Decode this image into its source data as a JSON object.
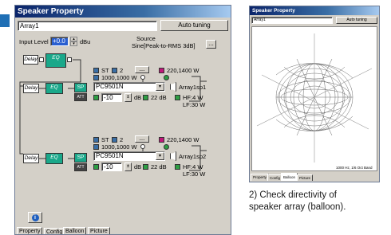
{
  "left_window": {
    "title": "Speaker Property",
    "name_value": "Array1",
    "auto_tuning": "Auto tuning",
    "input_level_label": "Input Level",
    "input_level_value": "+0.0",
    "input_level_unit": "dBu",
    "source_label": "Source",
    "source_value": "Sine[Peak-to-RMS 3dB]",
    "browse_label": "...",
    "blocks": {
      "delay": "Delay",
      "eq": "EQ",
      "sp": "SP",
      "att": "ATT"
    },
    "units": [
      {
        "st_label": "ST",
        "channel": "2",
        "power": "1000,1000 W",
        "model": "PC9501N",
        "speaker_power": "220,1400 W",
        "att": "-10",
        "att_unit": "dB",
        "gain": "22 dB",
        "hf": "HF:4 W",
        "lf": "LF:30 W",
        "output": "Array1sp1"
      },
      {
        "st_label": "ST",
        "channel": "2",
        "power": "1000,1000 W",
        "model": "PC9501N",
        "speaker_power": "220,1400 W",
        "att": "-10",
        "att_unit": "dB",
        "gain": "22 dB",
        "hf": "HF:4 W",
        "lf": "LF:30 W",
        "output": "Array1sp2"
      }
    ],
    "info_icon": "i",
    "tabs": [
      "Property",
      "Config",
      "Balloon",
      "Picture"
    ]
  },
  "right_window": {
    "title": "Speaker Property",
    "name_value": "Array1",
    "auto_tuning": "Auto tuning",
    "band_label": "1000 Hz, 1/6 Oct Band",
    "tabs": [
      "Property",
      "Config",
      "Balloon",
      "Picture"
    ]
  },
  "caption": {
    "line1": "2) Check directivity of",
    "line2": "speaker array (balloon)."
  },
  "colors": {
    "title_bar": "#0a246a",
    "block_teal": "#1aa88a",
    "bullet": "#1f6fb5",
    "balloon": "#6a6a6a"
  }
}
